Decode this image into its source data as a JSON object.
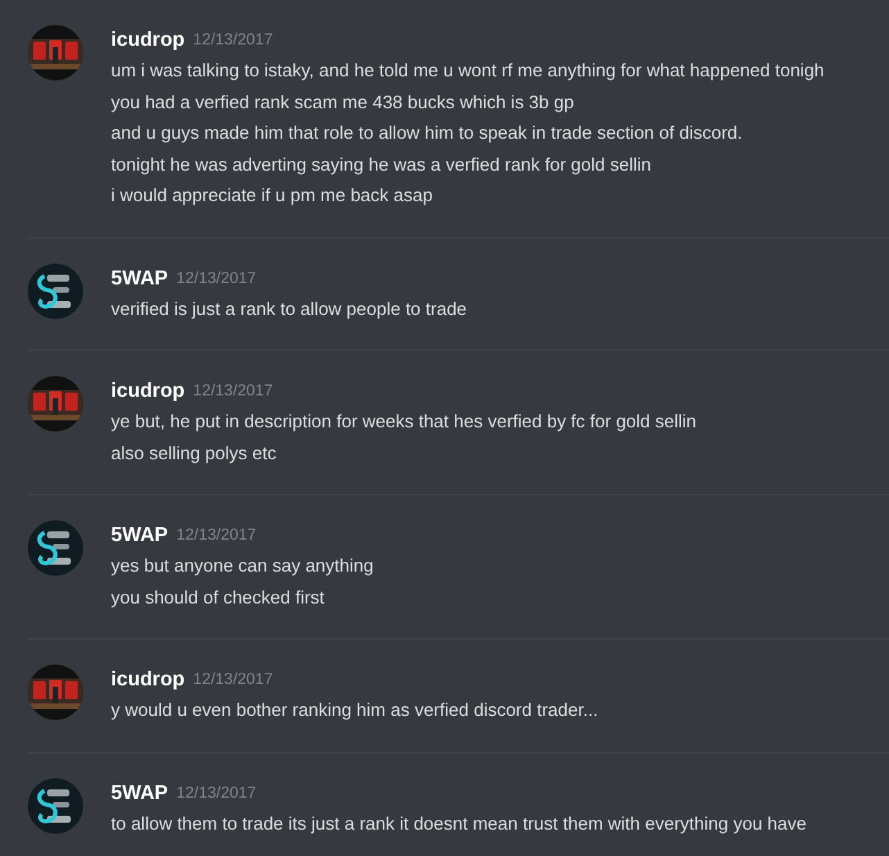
{
  "messages": [
    {
      "author": "icudrop",
      "timestamp": "12/13/2017",
      "avatar": {
        "kind": "picture"
      },
      "lines": [
        "um i was talking to istaky, and he told me u wont rf me anything for what happened tonigh",
        "you had a verfied rank scam me 438 bucks which is 3b gp",
        "and u guys made him that role to allow him to speak in trade section of discord.",
        "tonight he was adverting saying he was a verfied rank for gold sellin",
        "i would appreciate if u pm me back asap"
      ]
    },
    {
      "author": "5WAP",
      "timestamp": "12/13/2017",
      "avatar": {
        "kind": "emblem"
      },
      "lines": [
        "verified is just a rank to allow people to trade"
      ]
    },
    {
      "author": "icudrop",
      "timestamp": "12/13/2017",
      "avatar": {
        "kind": "picture"
      },
      "lines": [
        "ye but, he put in description for weeks that hes verfied by fc for gold sellin",
        "also selling polys etc"
      ]
    },
    {
      "author": "5WAP",
      "timestamp": "12/13/2017",
      "avatar": {
        "kind": "emblem"
      },
      "lines": [
        "yes but anyone can say anything",
        "you should of checked first"
      ]
    },
    {
      "author": "icudrop",
      "timestamp": "12/13/2017",
      "avatar": {
        "kind": "picture"
      },
      "lines": [
        "y would u even bother ranking him as verfied discord trader..."
      ]
    },
    {
      "author": "5WAP",
      "timestamp": "12/13/2017",
      "avatar": {
        "kind": "emblem"
      },
      "lines": [
        "to allow them to trade its just a rank it doesnt mean trust them with everything you have"
      ]
    }
  ]
}
